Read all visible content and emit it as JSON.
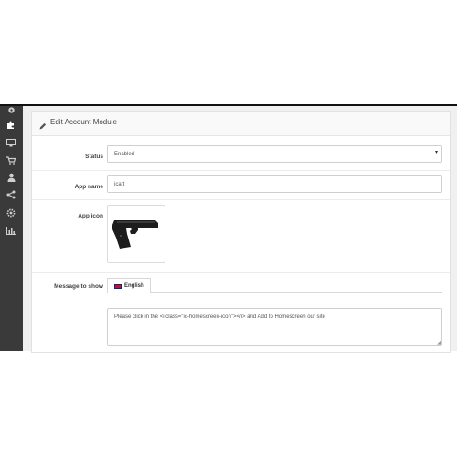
{
  "sidebar": {
    "icons": [
      "gear-icon",
      "puzzle-icon",
      "monitor-icon",
      "cart-icon",
      "user-icon",
      "share-icon",
      "cog-icon",
      "bar-chart-icon"
    ]
  },
  "panel": {
    "title": "Edit Account Module"
  },
  "form": {
    "status": {
      "label": "Status",
      "value": "Enabled"
    },
    "app_name": {
      "label": "App name",
      "value": "icart"
    },
    "app_icon": {
      "label": "App icon"
    },
    "message": {
      "label": "Message to show",
      "tab": "English",
      "value": "Please click in the <i class=\"ic-homescreen-icon\"></i> and Add to Homescreen our site"
    }
  }
}
